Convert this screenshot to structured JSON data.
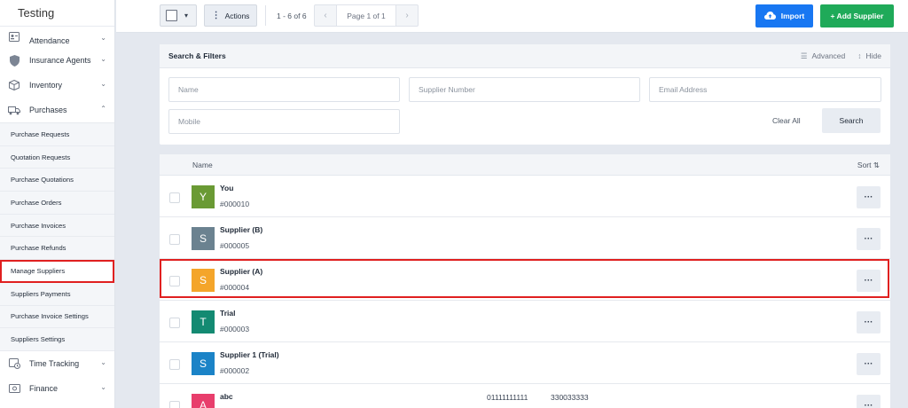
{
  "app": {
    "title": "Testing"
  },
  "sidebar": {
    "top_items": [
      {
        "label": "Attendance",
        "icon": "id-card-icon"
      },
      {
        "label": "Insurance Agents",
        "icon": "shield-icon"
      },
      {
        "label": "Inventory",
        "icon": "box-icon"
      },
      {
        "label": "Purchases",
        "icon": "truck-icon"
      }
    ],
    "purchases_sub": [
      "Purchase Requests",
      "Quotation Requests",
      "Purchase Quotations",
      "Purchase Orders",
      "Purchase Invoices",
      "Purchase Refunds",
      "Manage Suppliers",
      "Suppliers Payments",
      "Purchase Invoice Settings",
      "Suppliers Settings"
    ],
    "bottom_items": [
      {
        "label": "Time Tracking",
        "icon": "calendar-clock-icon"
      },
      {
        "label": "Finance",
        "icon": "money-icon"
      }
    ],
    "active": "Manage Suppliers"
  },
  "toolbar": {
    "actions_label": "Actions",
    "range": "1 - 6 of 6",
    "page_label": "Page 1 of 1",
    "import_label": "Import",
    "add_label": "+ Add Supplier"
  },
  "filters": {
    "title": "Search & Filters",
    "advanced": "Advanced",
    "hide": "Hide",
    "name_ph": "Name",
    "supplier_number_ph": "Supplier Number",
    "email_ph": "Email Address",
    "mobile_ph": "Mobile",
    "clear_all": "Clear All",
    "search": "Search"
  },
  "list": {
    "col_name": "Name",
    "sort_label": "Sort",
    "rows": [
      {
        "initial": "Y",
        "name": "You",
        "code": "#000010",
        "color": "#6a9a34"
      },
      {
        "initial": "S",
        "name": "Supplier (B)",
        "code": "#000005",
        "color": "#6b8290"
      },
      {
        "initial": "S",
        "name": "Supplier (A)",
        "code": "#000004",
        "color": "#f4a52a"
      },
      {
        "initial": "T",
        "name": "Trial",
        "code": "#000003",
        "color": "#138a72"
      },
      {
        "initial": "S",
        "name": "Supplier 1 (Trial)",
        "code": "#000002",
        "color": "#1b83c7"
      },
      {
        "initial": "A",
        "name": "abc",
        "code": "",
        "color": "#e83e6c",
        "phone1": "01111111111",
        "phone2": "330033333"
      }
    ]
  },
  "colors": {
    "import": "#1877f2",
    "add": "#1faa59",
    "highlight": "#e02020"
  }
}
